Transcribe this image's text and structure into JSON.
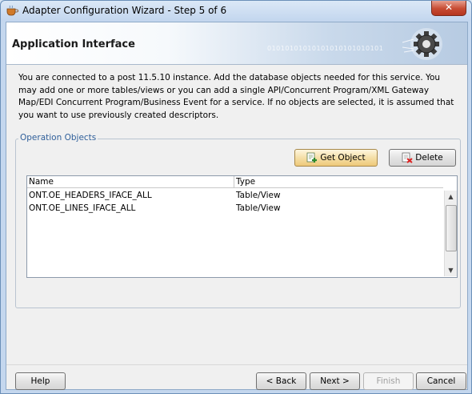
{
  "window": {
    "title": "Adapter Configuration Wizard - Step 5 of 6",
    "close_label": "✕"
  },
  "header": {
    "title": "Application Interface",
    "binary_text": "01010101010101010101010101"
  },
  "intro_text": "You are connected to a post 11.5.10 instance. Add the database objects needed for this service. You may add one or more tables/views or you can add a single API/Concurrent Program/XML Gateway Map/EDI Concurrent Program/Business Event for a service. If no objects are selected, it is assumed that you want to use previously created descriptors.",
  "operation_objects": {
    "legend": "Operation Objects",
    "get_object_label": "Get Object",
    "delete_label": "Delete",
    "columns": [
      "Name",
      "Type"
    ],
    "rows": [
      {
        "name": "ONT.OE_HEADERS_IFACE_ALL",
        "type": "Table/View"
      },
      {
        "name": "ONT.OE_LINES_IFACE_ALL",
        "type": "Table/View"
      }
    ]
  },
  "footer": {
    "help_label": "Help",
    "back_label": "< Back",
    "next_label": "Next >",
    "finish_label": "Finish",
    "cancel_label": "Cancel"
  }
}
